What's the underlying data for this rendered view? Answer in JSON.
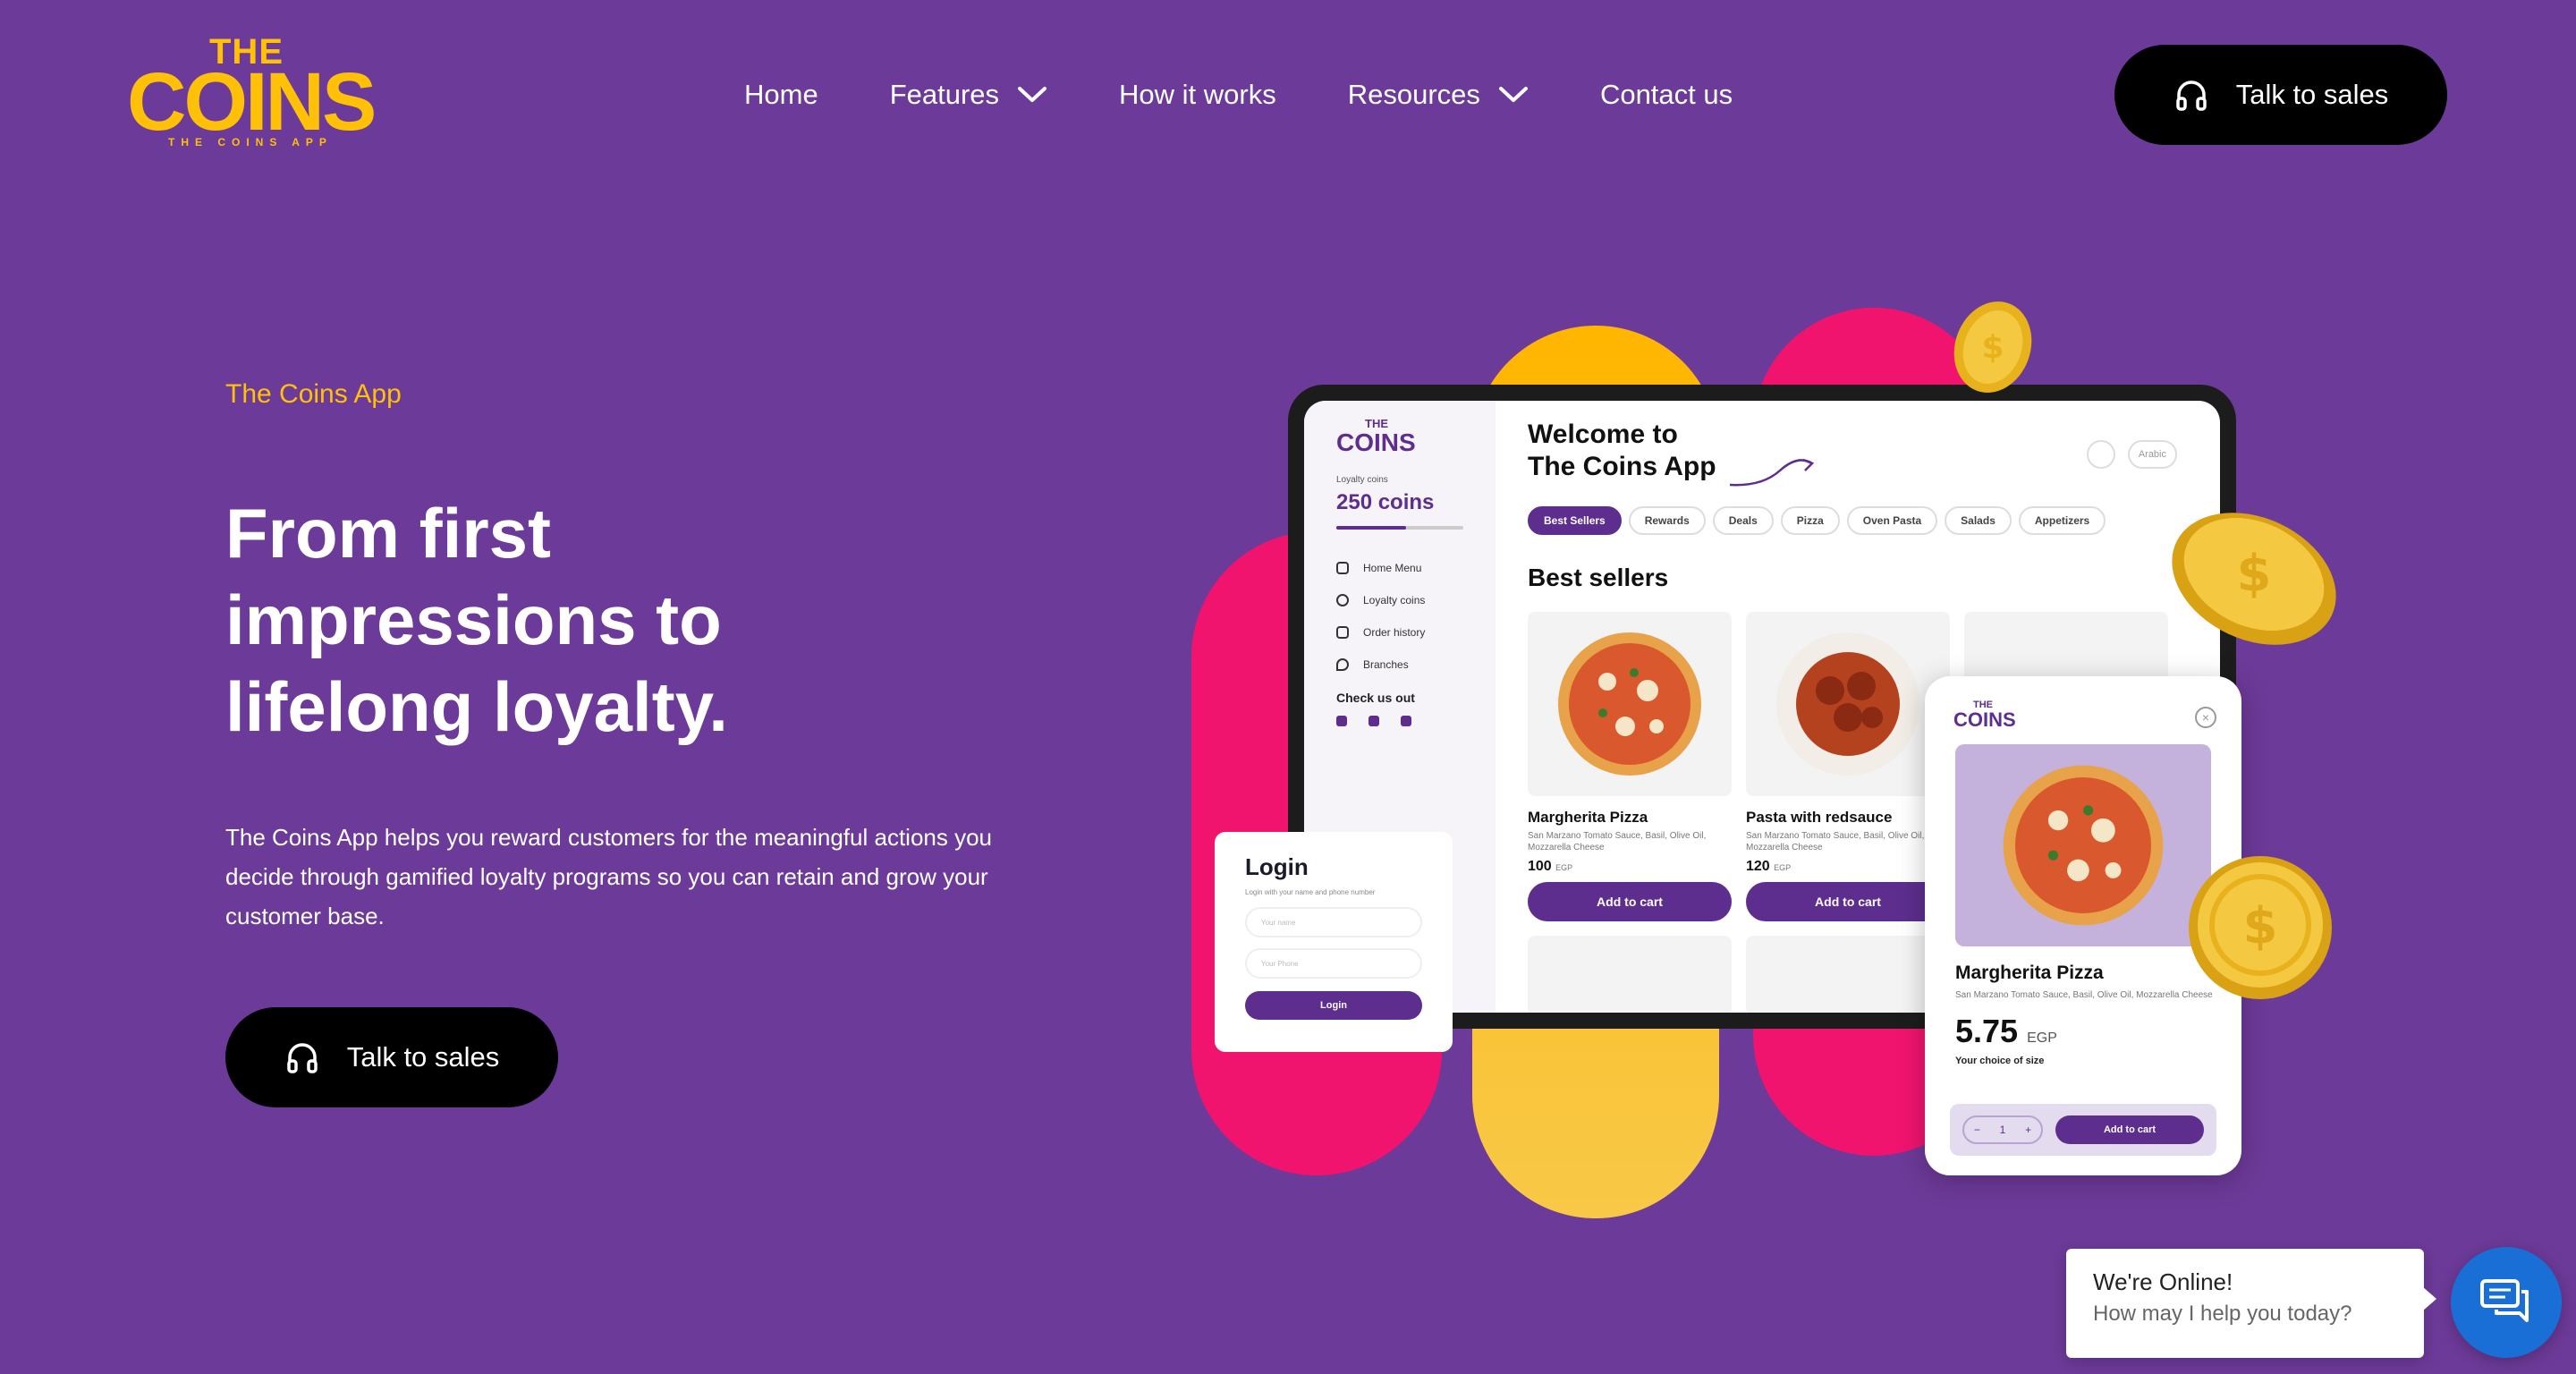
{
  "brand": {
    "the": "THE",
    "name": "COINS",
    "tagline": "THE COINS APP"
  },
  "nav": {
    "items": [
      {
        "label": "Home",
        "has_dropdown": false
      },
      {
        "label": "Features",
        "has_dropdown": true
      },
      {
        "label": "How it works",
        "has_dropdown": false
      },
      {
        "label": "Resources",
        "has_dropdown": true
      },
      {
        "label": "Contact us",
        "has_dropdown": false
      }
    ],
    "cta_label": "Talk to sales"
  },
  "hero": {
    "eyebrow": "The Coins App",
    "headline_lines": [
      "From first",
      "impressions to",
      "lifelong loyalty."
    ],
    "paragraph_lines": [
      "The Coins App helps you reward customers for the meaningful actions you",
      "decide through gamified loyalty programs so you can retain and grow your",
      "customer base."
    ],
    "cta_label": "Talk to sales"
  },
  "mockup": {
    "sidebar": {
      "logo_the": "THE",
      "logo_name": "COINS",
      "loyalty_label": "Loyalty coins",
      "coins": "250 coins",
      "progress": 0.55,
      "menu": [
        "Home Menu",
        "Loyalty coins",
        "Order history",
        "Branches"
      ],
      "check_us_out": "Check us out"
    },
    "welcome_lines": [
      "Welcome to",
      "The Coins App"
    ],
    "language": "Arabic",
    "chips": [
      "Best Sellers",
      "Rewards",
      "Deals",
      "Pizza",
      "Oven Pasta",
      "Salads",
      "Appetizers"
    ],
    "section_title": "Best sellers",
    "products": [
      {
        "name": "Margherita Pizza",
        "desc": "San Marzano Tomato Sauce, Basil, Olive Oil, Mozzarella Cheese",
        "price": "100",
        "currency": "EGP",
        "button": "Add to cart"
      },
      {
        "name": "Pasta with redsauce",
        "desc": "San Marzano Tomato Sauce, Basil, Olive Oil, Mozzarella Cheese",
        "price": "120",
        "currency": "EGP",
        "button": "Add to cart"
      }
    ],
    "login": {
      "title": "Login",
      "subtitle": "Login with your name and phone number",
      "name_placeholder": "Your name",
      "phone_placeholder": "Your Phone",
      "button": "Login"
    },
    "detail": {
      "logo_the": "THE",
      "logo_name": "COINS",
      "name": "Margherita Pizza",
      "desc": "San Marzano Tomato Sauce, Basil, Olive Oil, Mozzarella Cheese",
      "price": "5.75",
      "currency": "EGP",
      "size_label": "Your choice of size",
      "qty": "1",
      "button": "Add to cart"
    }
  },
  "chat": {
    "title": "We're Online!",
    "subtitle": "How may I help you today?"
  },
  "colors": {
    "background": "#6c3a98",
    "accent": "#ffc107",
    "pink": "#f0146e",
    "cta": "#000000",
    "chat": "#1a6fd6",
    "brand_purple": "#5d2e8e"
  }
}
